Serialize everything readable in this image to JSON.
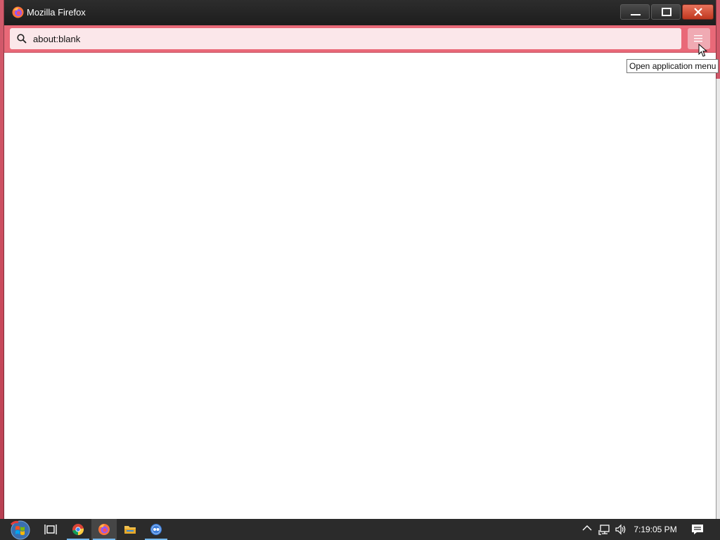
{
  "window": {
    "title": "Mozilla Firefox",
    "controls": {
      "minimize": "minimize-icon",
      "maximize": "maximize-icon",
      "close": "close-icon"
    }
  },
  "toolbar": {
    "url": "about:blank",
    "search_icon": "search-icon",
    "menu_icon": "hamburger-menu-icon"
  },
  "tooltip": {
    "text": "Open application menu"
  },
  "taskbar": {
    "apps": [
      {
        "name": "Start",
        "icon": "windows-start-icon"
      },
      {
        "name": "Task View",
        "icon": "task-view-icon"
      },
      {
        "name": "Google Chrome",
        "icon": "chrome-icon"
      },
      {
        "name": "Mozilla Firefox",
        "icon": "firefox-icon",
        "active": true
      },
      {
        "name": "File Explorer",
        "icon": "folder-icon"
      },
      {
        "name": "App",
        "icon": "app-icon"
      }
    ],
    "tray": {
      "icons": [
        "chevron-up-icon",
        "network-icon",
        "volume-icon"
      ],
      "clock": "7:19:05 PM",
      "notification_icon": "notification-icon"
    }
  },
  "colors": {
    "titlebar": "#1d1d1d",
    "toolbar": "#e96978",
    "urlbar": "#fbe7ea",
    "taskbar": "#2b2b2b",
    "close_button": "#c0381f",
    "active_indicator": "#76b9ed"
  }
}
